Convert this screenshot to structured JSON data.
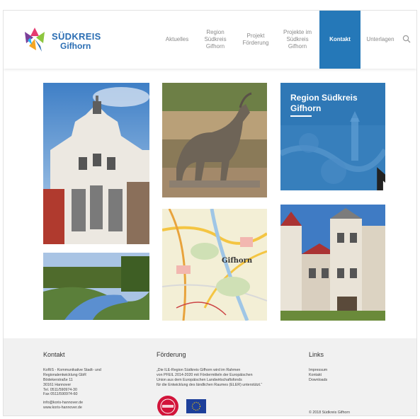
{
  "brand": {
    "line1": "SÜDKREIS",
    "line2": "Gifhorn"
  },
  "nav": {
    "items": [
      {
        "label": "Aktuelles"
      },
      {
        "label": "Region Südkreis Gifhorn"
      },
      {
        "label": "Projekt Förderung"
      },
      {
        "label": "Projekte im Südkreis Gifhorn"
      },
      {
        "label": "Kontakt",
        "active": true
      },
      {
        "label": "Unterlagen"
      }
    ],
    "search_icon": "search-icon"
  },
  "tiles": {
    "region_title": "Region Südkreis Gifhorn",
    "map_label": "Gifhorn"
  },
  "footer": {
    "kontakt": {
      "heading": "Kontakt",
      "lines": [
        "KoRiS - Kommunikative Stadt- und",
        "Regionalentwicklung GbR",
        "Bödekerstraße 11",
        "30161 Hannover",
        "Tel. 0511/590974-30",
        "Fax 0511/590974-60"
      ],
      "email": "info@koris-hannover.de",
      "web": "www.koris-hannover.de"
    },
    "foerderung": {
      "heading": "Förderung",
      "lines": [
        "„Die ILE-Region Südkreis Gifhorn wird im Rahmen",
        "von PFEIL 2014-2020 mit Fördermitteln der Europäischen",
        "Union aus dem Europäischen Landwirtschaftsfonds",
        "für die Entwicklung des ländlichen Raumes (ELER) unterstützt.“"
      ]
    },
    "links": {
      "heading": "Links",
      "items": [
        "Impressum",
        "Kontakt",
        "Downloads"
      ],
      "copyright": "© 2018 Südkreis Gifhorn"
    }
  },
  "colors": {
    "accent": "#2578b8",
    "footer_bg": "#f1f1f1"
  }
}
